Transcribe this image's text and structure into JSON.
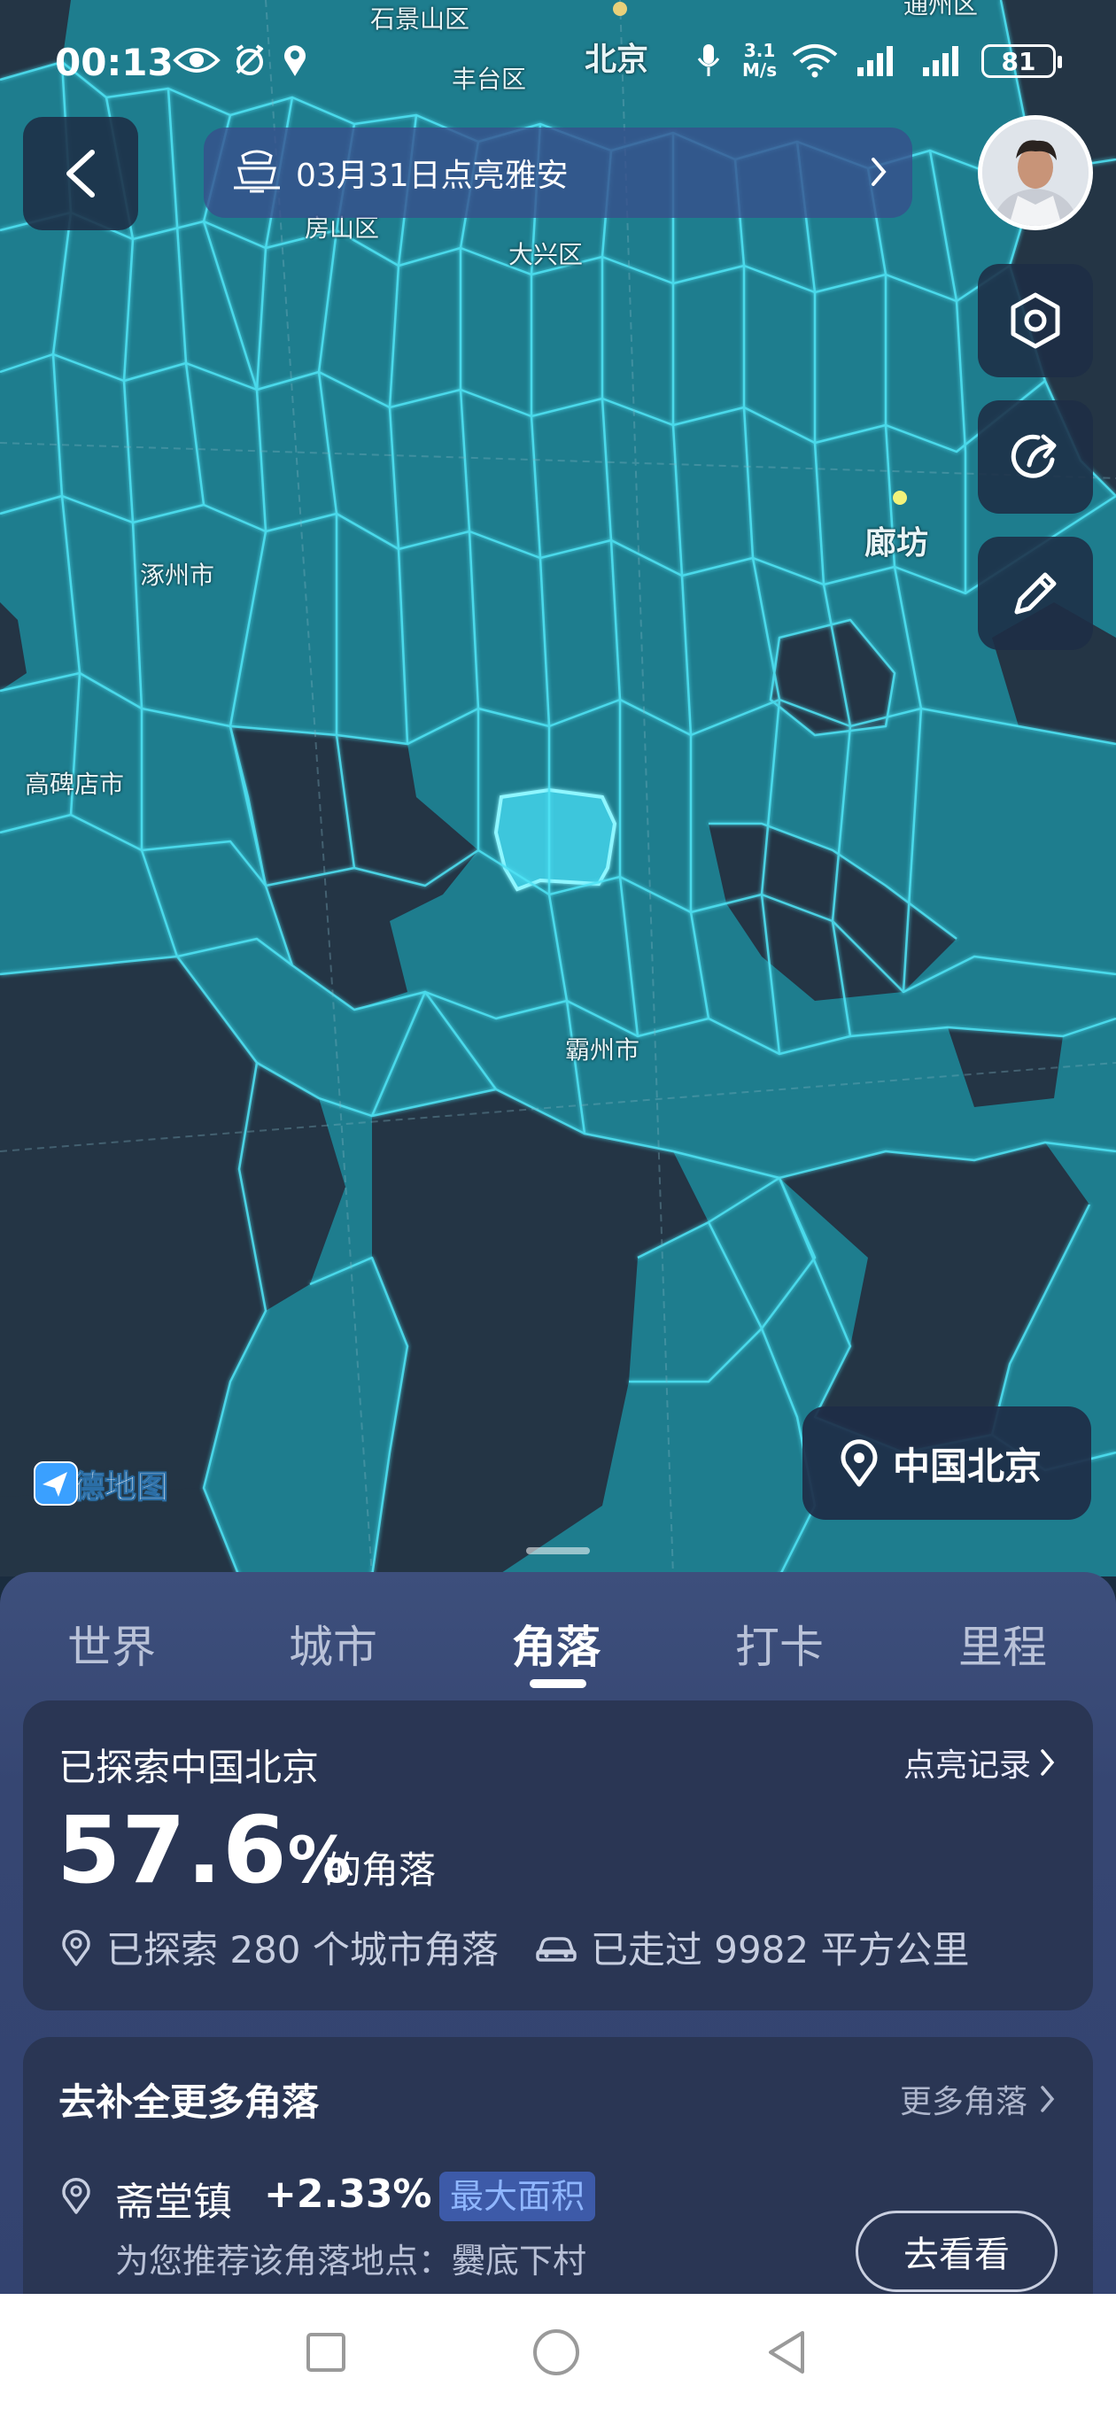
{
  "status_bar": {
    "time": "00:13",
    "net_speed_value": "3.1",
    "net_speed_unit": "M/s",
    "battery": "81"
  },
  "map": {
    "labels": [
      "石景山区",
      "丰台区",
      "北京",
      "房山区",
      "大兴区",
      "涿州市",
      "廊坊",
      "高碑店市",
      "霸州市",
      "通州区"
    ],
    "brand": "高德地图",
    "colors": {
      "explored": "#1e7d8e",
      "unexplored": "#243545",
      "boundary": "#4fe3f5",
      "selected": "#3cc6dc"
    }
  },
  "banner": {
    "text": "03月31日点亮雅安",
    "icon": "lantern-icon"
  },
  "side_buttons": [
    "settings-hexagon-icon",
    "share-icon",
    "edit-pencil-icon"
  ],
  "location_chip": {
    "label": "中国北京"
  },
  "tabs": [
    {
      "label": "世界",
      "active": false
    },
    {
      "label": "城市",
      "active": false
    },
    {
      "label": "角落",
      "active": true
    },
    {
      "label": "打卡",
      "active": false
    },
    {
      "label": "里程",
      "active": false
    }
  ],
  "summary": {
    "title": "已探索中国北京",
    "record_link": "点亮记录",
    "percent": "57.6",
    "percent_sign": "%",
    "percent_suffix": "的角落",
    "explored_corners": "已探索 280 个城市角落",
    "area_walked": "已走过 9982 平方公里"
  },
  "recommend": {
    "title": "去补全更多角落",
    "more_link": "更多角落",
    "place": "斋堂镇",
    "gain": "+2.33%",
    "badge": "最大面积",
    "subtitle": "为您推荐该角落地点：爨底下村",
    "button": "去看看"
  }
}
